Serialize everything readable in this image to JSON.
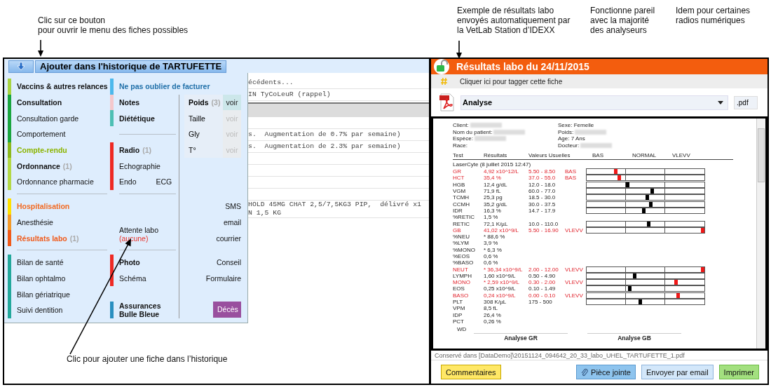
{
  "notes": {
    "menu_button": "Clic sur ce bouton\npour ouvrir le menu des fiches possibles",
    "lab_results": "Exemple de résultats labo\nenvoyés automatiquement par\nla VetLab Station d’IDEXX",
    "analyzers": "Fonctionne pareil\navec la majorité\ndes analyseurs",
    "radios": "Idem pour certaines\nradios numériques",
    "add_entry": "Clic pour ajouter une fiche dans l’historique"
  },
  "left": {
    "title_button": "Ajouter dans l'historique de TARTUFETTE",
    "menu": {
      "sections": [
        {
          "separated": false,
          "col1": [
            {
              "kind": "group",
              "color": "#a8d443",
              "items": [
                {
                  "label": "Vaccins & autres relances",
                  "bold": true
                }
              ]
            }
          ],
          "col2": [
            {
              "kind": "group",
              "color": "#4cb8ec",
              "items": [
                {
                  "label": "Ne pas oublier de facturer",
                  "bold": true,
                  "color": "#1f6fa8"
                }
              ]
            }
          ]
        },
        {
          "separated": false,
          "col1": [
            {
              "kind": "group",
              "color": "#1aa540",
              "items": [
                {
                  "label": "Consultation",
                  "bold": true
                },
                {
                  "label": "Consultation garde",
                  "bold": false
                },
                {
                  "label": "Comportement",
                  "bold": false
                }
              ]
            },
            {
              "kind": "group",
              "color": "#8cb81e",
              "items": [
                {
                  "label": "Compte-rendu",
                  "bold": true,
                  "color": "#8cb400"
                }
              ]
            },
            {
              "kind": "group",
              "color": "#b4d846",
              "items": [
                {
                  "label": "Ordonnance",
                  "bold": true,
                  "count": "(1)"
                },
                {
                  "label": "Ordonnance pharmacie",
                  "bold": false
                }
              ]
            }
          ],
          "col2": [
            {
              "kind": "group",
              "color": "#f4c8cc",
              "items": [
                {
                  "label": "Notes",
                  "bold": true
                }
              ]
            },
            {
              "kind": "group",
              "color": "#4dbfb4",
              "items": [
                {
                  "label": "Diététique",
                  "bold": true
                }
              ]
            },
            {
              "kind": "divider"
            },
            {
              "kind": "group",
              "color": "#ee2a24",
              "items": [
                {
                  "label": "Radio",
                  "bold": true,
                  "count": "(1)"
                },
                {
                  "label": "Echographie",
                  "bold": false
                },
                {
                  "label": "Endo",
                  "bold": false,
                  "extra": "ECG"
                }
              ]
            }
          ],
          "col3": [
            {
              "kind": "weights",
              "rows": [
                {
                  "label": "Poids",
                  "bold": true,
                  "count": "(3)",
                  "link": "voir",
                  "disabled": false
                },
                {
                  "label": "Taille",
                  "bold": false,
                  "link": "voir",
                  "disabled": true
                },
                {
                  "label": "Gly",
                  "bold": false,
                  "link": "voir",
                  "disabled": true
                },
                {
                  "label": "T°",
                  "bold": false,
                  "link": "voir",
                  "disabled": true
                }
              ]
            }
          ]
        },
        {
          "separated": true,
          "col1": [
            {
              "kind": "group",
              "color": "#ffe000",
              "items": [
                {
                  "label": "Hospitalisation",
                  "bold": true,
                  "color": "#f26a22"
                }
              ]
            },
            {
              "kind": "group",
              "color": "#f39a2a",
              "items": [
                {
                  "label": "Anesthésie",
                  "bold": false
                }
              ]
            },
            {
              "kind": "group",
              "color": "#f05a1a",
              "items": [
                {
                  "label": "Résultats labo",
                  "bold": true,
                  "color": "#f05a1a",
                  "count": "(1)"
                }
              ]
            }
          ],
          "col2": [
            {
              "kind": "status",
              "label": "Attente labo",
              "value": "(aucune)"
            }
          ],
          "col3": [
            {
              "kind": "group",
              "items": [
                {
                  "label": "SMS",
                  "bold": false
                },
                {
                  "label": "email",
                  "bold": false
                },
                {
                  "label": "courrier",
                  "bold": false
                }
              ]
            }
          ]
        },
        {
          "separated": true,
          "col1": [
            {
              "kind": "group",
              "color": "#23a89c",
              "items": [
                {
                  "label": "Bilan de santé",
                  "bold": false
                },
                {
                  "label": "Bilan ophtalmo",
                  "bold": false
                },
                {
                  "label": "Bilan gériatrique",
                  "bold": false
                },
                {
                  "label": "Suivi dentition",
                  "bold": false
                }
              ]
            }
          ],
          "col2": [
            {
              "kind": "group",
              "color": "#ee2a24",
              "items": [
                {
                  "label": "Photo",
                  "bold": true
                },
                {
                  "label": "Schéma",
                  "bold": false
                }
              ]
            },
            {
              "kind": "group",
              "color": "#2a8fc0",
              "items": [
                {
                  "label": "Assurances Bulle Bleue",
                  "bold": true
                }
              ]
            }
          ],
          "col3": [
            {
              "kind": "group",
              "items": [
                {
                  "label": "Conseil",
                  "bold": false
                },
                {
                  "label": "Formulaire",
                  "bold": false
                }
              ]
            },
            {
              "kind": "button",
              "label": "Décès"
            }
          ]
        }
      ]
    },
    "history": {
      "rows": [
        {
          "kind": "text",
          "lines": [
            "écédents..."
          ]
        },
        {
          "kind": "text",
          "lines": [
            "IN TyCoLeuR (rappel)"
          ]
        },
        {
          "kind": "band"
        },
        {
          "kind": "blank"
        },
        {
          "kind": "text",
          "lines": [
            "s.  Augmentation de 0.7% par semaine)"
          ]
        },
        {
          "kind": "text",
          "lines": [
            "s.  Augmentation de 2.3% par semaine)"
          ]
        },
        {
          "kind": "blank"
        },
        {
          "kind": "blank"
        },
        {
          "kind": "blank"
        },
        {
          "kind": "blank"
        },
        {
          "kind": "text",
          "lines": [
            "HOLD 45MG CHAT 2,5/7,5KG3 PIP,  délivré x1",
            "N 1,5 KG"
          ]
        }
      ]
    }
  },
  "right": {
    "title": "Résultats labo du 24/11/2015",
    "tag_hint": "Cliquer ici pour tagger cette fiche",
    "document_select": {
      "value": "Analyse"
    },
    "extension_field": {
      "value": ".pdf"
    },
    "report": {
      "info_left": [
        {
          "label": "Client:",
          "kind": "redacted"
        },
        {
          "label": "Nom du patient:",
          "kind": "redacted"
        },
        {
          "label": "Espèce:",
          "kind": "redacted"
        },
        {
          "label": "Race:",
          "kind": "text"
        }
      ],
      "info_right": [
        {
          "label": "Sexe: Femelle",
          "kind": "text"
        },
        {
          "label": "Poids:",
          "kind": "redacted"
        },
        {
          "label": "Age: 7 Ans",
          "kind": "text"
        },
        {
          "label": "Docteur:",
          "kind": "redacted"
        }
      ],
      "columns": [
        "Test",
        "Résultats",
        "Valeurs Usuelles",
        "BAS",
        "NORMAL",
        "VLEVV"
      ],
      "run": "LaserCyte (8 juillet 2015 12:47)",
      "rows": [
        {
          "test": "GR",
          "result": "4,92 x10^12/L",
          "range": "5.50 - 8.50",
          "flag": "BAS",
          "abnormal": true,
          "level": 0.25
        },
        {
          "test": "HCT",
          "result": "35,4 %",
          "range": "37.0 - 55.0",
          "flag": "BAS",
          "abnormal": true,
          "level": 0.28
        },
        {
          "test": "HGB",
          "result": "12,4 g/dL",
          "range": "12.0 - 18.0",
          "abnormal": false,
          "level": 0.35
        },
        {
          "test": "VGM",
          "result": "71,9 fL",
          "range": "60.0 - 77.0",
          "abnormal": false,
          "level": 0.56
        },
        {
          "test": "TCMH",
          "result": "25,3 pg",
          "range": "18.5 - 30.0",
          "abnormal": false,
          "level": 0.52
        },
        {
          "test": "CCMH",
          "result": "35,2 g/dL",
          "range": "30.0 - 37.5",
          "abnormal": false,
          "level": 0.55
        },
        {
          "test": "IDR",
          "result": "16,3 %",
          "range": "14.7 - 17.9",
          "abnormal": false,
          "level": 0.49
        },
        {
          "test": "%RETIC",
          "result": "1,5 %",
          "abnormal": false
        },
        {
          "test": "RETIC",
          "result": "72,1 K/µL",
          "range": "10.0 - 110.0",
          "abnormal": false,
          "level": 0.53
        },
        {
          "test": "GB",
          "result": "41,02 x10^9/L",
          "range": "5.50 - 16.90",
          "flag": "VLEVV",
          "abnormal": true,
          "level": 0.99
        },
        {
          "test": "%NEU",
          "result": "* 88,6 %",
          "abnormal": false
        },
        {
          "test": "%LYM",
          "result": "3,9 %",
          "abnormal": false
        },
        {
          "test": "%MONO",
          "result": "* 6,3 %",
          "abnormal": false
        },
        {
          "test": "%EOS",
          "result": "0,6 %",
          "abnormal": false
        },
        {
          "test": "%BASO",
          "result": "0,6 %",
          "abnormal": false
        },
        {
          "test": "NEUT",
          "result": "* 36,34 x10^9/L",
          "range": "2.00 - 12.00",
          "flag": "VLEVV",
          "abnormal": true,
          "level": 0.99
        },
        {
          "test": "LYMPH",
          "result": "1,60 x10^9/L",
          "range": "0.50 - 4.90",
          "abnormal": false,
          "level": 0.41
        },
        {
          "test": "MONO",
          "result": "* 2,59 x10^9/L",
          "range": "0.30 - 2.00",
          "flag": "VLEVV",
          "abnormal": true,
          "level": 0.76
        },
        {
          "test": "EOS",
          "result": "0,25 x10^9/L",
          "range": "0.10 - 1.49",
          "abnormal": false,
          "level": 0.37
        },
        {
          "test": "BASO",
          "result": "0,24 x10^9/L",
          "range": "0.00 - 0.10",
          "flag": "VLEVV",
          "abnormal": true,
          "level": 0.78
        },
        {
          "test": "PLT",
          "result": "308 K/µL",
          "range": "175 - 500",
          "abnormal": false,
          "level": 0.46
        },
        {
          "test": "VPM",
          "result": "8,5 fL",
          "abnormal": false
        },
        {
          "test": "IDP",
          "result": "26,4 %",
          "abnormal": false
        },
        {
          "test": "PCT",
          "result": "0,26 %",
          "abnormal": false
        }
      ],
      "footer_label": "WD",
      "charts": [
        "Analyse GR",
        "Analyse GB"
      ]
    },
    "saved_path": "Conservé dans [DataDemo]\\20151124_094642_20_33_labo_UHEL_TARTUFETTE_1.pdf",
    "buttons": [
      {
        "label": "Commentaires",
        "kind": "comment"
      },
      {
        "label": "Pièce jointe",
        "kind": "attach"
      },
      {
        "label": "Envoyer par email",
        "kind": "email"
      },
      {
        "label": "Imprimer",
        "kind": "print"
      }
    ]
  }
}
